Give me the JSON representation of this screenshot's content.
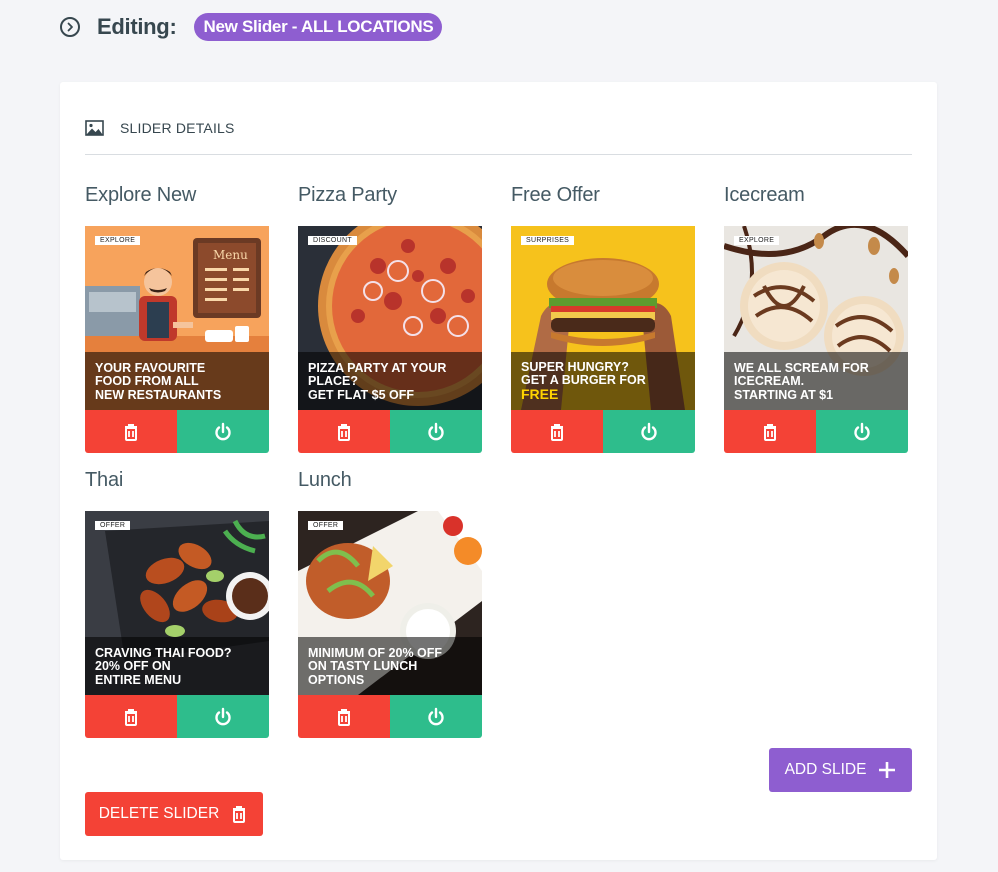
{
  "header": {
    "title": "Editing:",
    "badge": "New Slider - ALL LOCATIONS"
  },
  "panel": {
    "section_label": "SLIDER DETAILS"
  },
  "slides": [
    {
      "name": "Explore New",
      "tag": "EXPLORE",
      "caption": "YOUR FAVOURITE\nFOOD FROM ALL\nNEW RESTAURANTS",
      "highlight": ""
    },
    {
      "name": "Pizza Party",
      "tag": "DISCOUNT",
      "caption": "PIZZA PARTY AT YOUR\nPLACE?\nGET FLAT $5 OFF",
      "highlight": ""
    },
    {
      "name": "Free Offer",
      "tag": "SURPRISES",
      "caption": "SUPER HUNGRY?\nGET A BURGER FOR",
      "highlight": "FREE"
    },
    {
      "name": "Icecream",
      "tag": "EXPLORE",
      "caption": "WE ALL SCREAM FOR\nICECREAM.\nSTARTING AT $1",
      "highlight": ""
    },
    {
      "name": "Thai",
      "tag": "OFFER",
      "caption": "CRAVING THAI FOOD?\n20% OFF ON\nENTIRE MENU",
      "highlight": ""
    },
    {
      "name": "Lunch",
      "tag": "OFFER",
      "caption": "MINIMUM OF 20% OFF\nON TASTY LUNCH\nOPTIONS",
      "highlight": ""
    }
  ],
  "buttons": {
    "add_slide": "ADD SLIDE",
    "delete_slider": "DELETE SLIDER"
  },
  "colors": {
    "accent_purple": "#8e5ed0",
    "delete_red": "#f44236",
    "toggle_green": "#2ebd8c"
  },
  "icons": {
    "header": "chevron-circle-right-icon",
    "section": "image-icon",
    "delete": "trash-icon",
    "toggle": "power-icon",
    "add": "plus-icon"
  }
}
